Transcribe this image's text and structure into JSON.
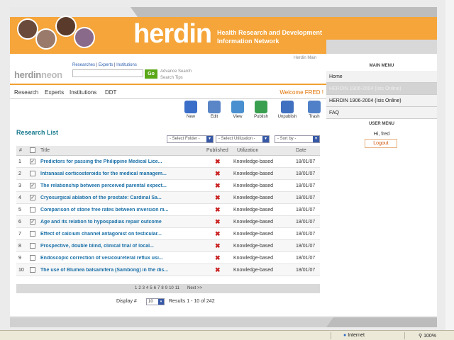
{
  "banner": {
    "logo": "herdin",
    "tagline": "Health Research and Development Information Network"
  },
  "header": {
    "right_link": "Herdin Main"
  },
  "herdinneon": {
    "part1": "herdin",
    "part2": "neon"
  },
  "search": {
    "links": [
      "Researches",
      "Experts",
      "Institutions"
    ],
    "go_label": "Go",
    "advance_search": "Advance Search",
    "search_tips": "Search Tips"
  },
  "topnav": {
    "items": [
      "Research",
      "Experts",
      "Institutions",
      "DDT"
    ],
    "welcome": "Welcome FRED !"
  },
  "toolbar": [
    {
      "label": "New",
      "icon": "new-folder-icon",
      "color": "#3a6ec8"
    },
    {
      "label": "Edit",
      "icon": "edit-icon",
      "color": "#5a86c8"
    },
    {
      "label": "View",
      "icon": "view-icon",
      "color": "#4a90d0"
    },
    {
      "label": "Publish",
      "icon": "publish-icon",
      "color": "#3aa050"
    },
    {
      "label": "Unpublish",
      "icon": "unpublish-icon",
      "color": "#4070c0"
    },
    {
      "label": "Trash",
      "icon": "trash-icon",
      "color": "#5080c8"
    }
  ],
  "research_list": {
    "title": "Research List",
    "filters": {
      "folder": "- Select Folder -",
      "utilization": "- Select Utilization -",
      "sort": "- Sort by -"
    },
    "columns": {
      "num": "#",
      "title": "Title",
      "published": "Published",
      "utilization": "Utilization",
      "date": "Date"
    },
    "rows": [
      {
        "num": "1",
        "checked": true,
        "title": "Predictors for passing the Philippine Medical Lice...",
        "utilization": "Knowledge-based",
        "date": "18/01/07"
      },
      {
        "num": "2",
        "checked": false,
        "title": "Intranasal corticosteroids for the medical managem...",
        "utilization": "Knowledge-based",
        "date": "18/01/07"
      },
      {
        "num": "3",
        "checked": true,
        "title": "The relationship between perceived parental expect...",
        "utilization": "Knowledge-based",
        "date": "18/01/07"
      },
      {
        "num": "4",
        "checked": true,
        "title": "Cryosurgical ablation of the prostate: Cardinal Sa...",
        "utilization": "Knowledge-based",
        "date": "18/01/07"
      },
      {
        "num": "5",
        "checked": false,
        "title": "Comparison of stone free rates between inversion m...",
        "utilization": "Knowledge-based",
        "date": "18/01/07"
      },
      {
        "num": "6",
        "checked": true,
        "title": "Age and its relation to hypospadias repair outcome",
        "utilization": "Knowledge-based",
        "date": "18/01/07"
      },
      {
        "num": "7",
        "checked": false,
        "title": "Effect of calcium channel antagonist on testicular...",
        "utilization": "Knowledge-based",
        "date": "18/01/07"
      },
      {
        "num": "8",
        "checked": false,
        "title": "Prospective, double blind, clinical trial of local...",
        "utilization": "Knowledge-based",
        "date": "18/01/07"
      },
      {
        "num": "9",
        "checked": false,
        "title": "Endoscopic correction of vesicoureteral reflux usi...",
        "utilization": "Knowledge-based",
        "date": "18/01/07"
      },
      {
        "num": "10",
        "checked": false,
        "title": "The use of Blumea balsamifera (Sambong) in the dis...",
        "utilization": "Knowledge-based",
        "date": "18/01/07"
      }
    ],
    "pager": {
      "pages": [
        "1",
        "2",
        "3",
        "4",
        "5",
        "6",
        "7",
        "8",
        "9",
        "10",
        "11"
      ],
      "next": "Next >>"
    },
    "display_label": "Display #",
    "display_value": "10",
    "results": "Results 1 - 10 of 242"
  },
  "sidebar": {
    "main_menu_title": "MAIN MENU",
    "items": [
      "Home",
      "HERDIN 1906-2004 (Isis Online)",
      "HERDIN 1906-2004 (Isis Online)",
      "FAQ"
    ],
    "user_menu_title": "USER MENU",
    "greeting": "Hi, fred",
    "logout": "Logout"
  },
  "statusbar": {
    "zone": "Internet",
    "zoom": "100%"
  },
  "colors": {
    "accent": "#f5a53a",
    "link": "#1a70a8",
    "published_x": "#c9201f",
    "go": "#5aa818"
  }
}
